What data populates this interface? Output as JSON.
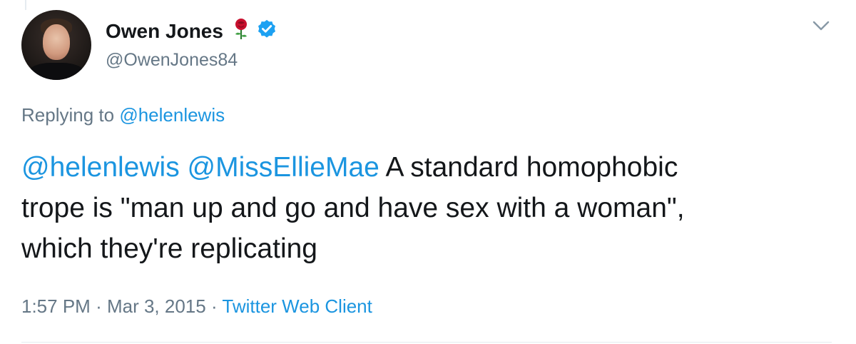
{
  "author": {
    "name": "Owen Jones",
    "handle": "@OwenJones84",
    "name_emoji_icon": "rose-icon",
    "verified_icon": "verified-badge-icon"
  },
  "menu": {
    "icon": "chevron-down-icon"
  },
  "reply": {
    "prefix": "Replying to",
    "target": "@helenlewis"
  },
  "tweet": {
    "mention_1": "@helenlewis",
    "mention_2": "@MissEllieMae",
    "line_1_rest": "A standard homophobic",
    "line_2": "trope is \"man up and go and have sex with a woman\",",
    "line_3": "which they're replicating"
  },
  "meta": {
    "time": "1:57 PM",
    "separator": "·",
    "date": "Mar 3, 2015",
    "source": "Twitter Web Client"
  },
  "colors": {
    "link": "#1b95e0",
    "muted": "#657786",
    "text": "#14171a",
    "verified": "#1da1f2",
    "rose": "#c8102e"
  }
}
